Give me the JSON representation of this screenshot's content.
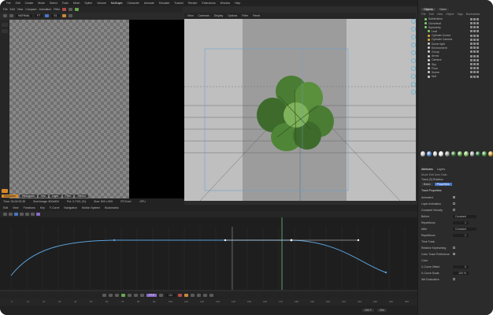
{
  "app": {
    "menus": [
      "File",
      "Edit",
      "Create",
      "Mode",
      "Select",
      "Tools",
      "Mesh",
      "Spline",
      "Volume",
      "MoGraph",
      "Character",
      "Animate",
      "Simulate",
      "Tracker",
      "Render",
      "Extensions",
      "Window",
      "Help"
    ],
    "active_menu": "Modes"
  },
  "left_toolbar": {
    "pv_menus": [
      "File",
      "Edit",
      "View",
      "Compare",
      "Animation",
      "Filter"
    ],
    "field_mode": "NORMAL",
    "field_fps": "FT",
    "badge": "S1"
  },
  "picture_viewer": {
    "tabs": [
      "Navigator",
      "Histogram",
      "Info",
      "Layer",
      "Filter",
      "Stereo"
    ],
    "active_tab": "Navigator",
    "status": [
      "Time: 00:00:00:35",
      "Size/Image: 800x800",
      "Pct: 0.7/0/1 (%)",
      "Size: 800 x 800",
      "RT/Cont:",
      "GPU"
    ]
  },
  "viewport": {
    "menus": [
      "View",
      "Cameras",
      "Display",
      "Options",
      "Filter",
      "Panel"
    ],
    "colors": {
      "bg": "#bfbfbf",
      "inner": "#9c9c9c",
      "clover_dark": "#3e6b2c",
      "clover_light": "#7fb25a"
    }
  },
  "object_manager": {
    "tabs": [
      "Objects",
      "Takes"
    ],
    "active_tab": "Objects",
    "menus": [
      "File",
      "Edit",
      "View",
      "Object",
      "Tags",
      "Bookmarks"
    ],
    "items": [
      {
        "name": "Subdivision",
        "color": "#7fd46b"
      },
      {
        "name": "Cloverleaf",
        "color": "#7fd46b"
      },
      {
        "name": "Symmetry",
        "color": "#7fd46b"
      },
      {
        "name": "Leaf",
        "color": "#7fd46b"
      },
      {
        "name": "Cylinder Cursor",
        "color": "#e0b040"
      },
      {
        "name": "Cylinder Camera",
        "color": "#e0b040"
      },
      {
        "name": "Dome light",
        "color": "#d0d0d0"
      },
      {
        "name": "Environment",
        "color": "#d0d0d0"
      },
      {
        "name": "Group",
        "color": "#d0d0d0"
      },
      {
        "name": "Arrow",
        "color": "#d0d0d0"
      },
      {
        "name": "Camera",
        "color": "#d0d0d0"
      },
      {
        "name": "Sky",
        "color": "#d0d0d0"
      },
      {
        "name": "Floor",
        "color": "#d0d0d0"
      },
      {
        "name": "Scene",
        "color": "#d0d0d0"
      },
      {
        "name": "Null",
        "color": "#d0d0d0"
      }
    ]
  },
  "materials": [
    "#c9c9c9",
    "#5a8fd6",
    "#d6d6d6",
    "#e8e8e8",
    "#9a9a9a",
    "#3d7a3d",
    "#6aa84f",
    "#88c06a",
    "#b0b0b0",
    "#2a6a3a",
    "#4a9a4a",
    "#d0a040"
  ],
  "attributes": {
    "tabs": [
      "Attributes",
      "Layers"
    ],
    "active_tab": "Attributes",
    "menus": "Mode  Edit  User Data",
    "track_line": "Track [X] Rotation",
    "modes": [
      "Basic",
      "Properties"
    ],
    "active_mode": "Properties",
    "section": "Track Properties",
    "rows": [
      {
        "label": "Animated",
        "type": "check",
        "on": true
      },
      {
        "label": "Layer Animation",
        "type": "check",
        "on": false
      },
      {
        "label": "Constant Velocity",
        "type": "check",
        "on": false
      },
      {
        "label": "Before",
        "type": "dropdown",
        "value": "Constant"
      },
      {
        "label": "Repetitions",
        "type": "number",
        "value": "1"
      },
      {
        "label": "After",
        "type": "dropdown",
        "value": "Constant"
      },
      {
        "label": "Repetitions",
        "type": "number",
        "value": "1"
      },
      {
        "label": "Time Track",
        "type": "text",
        "value": ""
      },
      {
        "label": "Relative Keyframing",
        "type": "check",
        "on": false
      },
      {
        "label": "Color Track Preference",
        "type": "check",
        "on": true
      },
      {
        "label": "Color",
        "type": "text",
        "value": ""
      },
      {
        "label": "X-Curve Offset",
        "type": "number",
        "value": "0"
      },
      {
        "label": "X-Curve Scale",
        "type": "number",
        "value": "100 %"
      },
      {
        "label": "Wrt Evaluation",
        "type": "check",
        "on": false
      }
    ]
  },
  "timeline": {
    "menus": [
      "Edit",
      "View",
      "Functions",
      "Key",
      "F-Curve",
      "Navigation",
      "Motion System",
      "Bookmarks"
    ],
    "ruler": [
      "0",
      "10",
      "20",
      "30",
      "40",
      "50",
      "60",
      "70",
      "80",
      "90",
      "100",
      "110",
      "120",
      "130",
      "140",
      "150",
      "160",
      "170",
      "180",
      "190",
      "200",
      "210",
      "220",
      "230",
      "240",
      "250"
    ],
    "current_frame": "59 F",
    "frame_readout": "111",
    "total_frames": "250"
  },
  "playback": {
    "frame_box": "77 F",
    "end_box": "250 F"
  },
  "status": [
    "Nav",
    "Fine",
    "RT"
  ]
}
